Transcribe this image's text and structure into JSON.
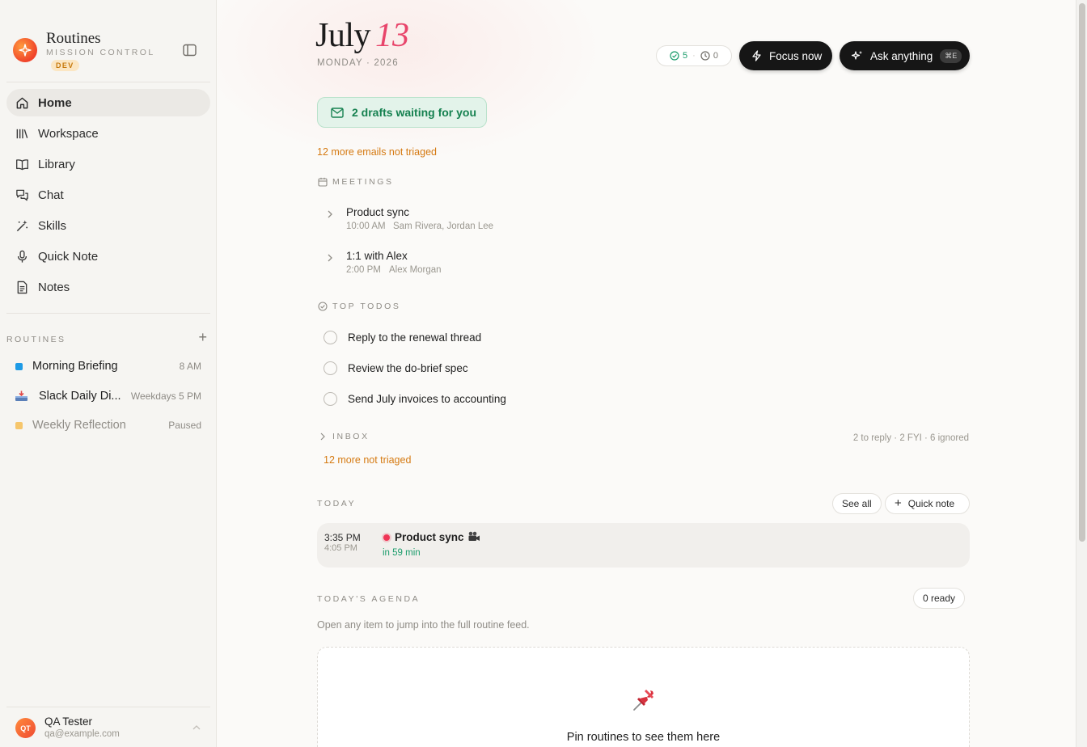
{
  "sidebar": {
    "brand": {
      "title": "Routines",
      "subtitle": "MISSION CONTROL",
      "badge": "DEV"
    },
    "nav": [
      {
        "label": "Home",
        "icon": "home-icon",
        "active": true
      },
      {
        "label": "Workspace",
        "icon": "books-icon"
      },
      {
        "label": "Library",
        "icon": "book-icon"
      },
      {
        "label": "Chat",
        "icon": "chat-icon"
      },
      {
        "label": "Skills",
        "icon": "wand-icon"
      },
      {
        "label": "Quick Note",
        "icon": "microphone-icon"
      },
      {
        "label": "Notes",
        "icon": "document-icon"
      }
    ],
    "routines_label": "ROUTINES",
    "routines": [
      {
        "name": "Morning Briefing",
        "meta": "8 AM",
        "color": "#1e9be6"
      },
      {
        "name": "Slack Daily Di...",
        "meta": "Weekdays 5 PM",
        "icon": "inbox-tray-icon"
      },
      {
        "name": "Weekly Reflection",
        "meta": "Paused",
        "color": "#f6c66c",
        "paused": true
      }
    ],
    "user": {
      "initials": "QT",
      "name": "QA Tester",
      "email": "qa@example.com"
    }
  },
  "header": {
    "month": "July",
    "day": "13",
    "subtitle": "MONDAY · 2026",
    "stats": {
      "done": "5",
      "pending": "0"
    },
    "focus_label": "Focus now",
    "ask_label": "Ask anything",
    "ask_shortcut": "⌘E"
  },
  "drafts_label": "2 drafts waiting for you",
  "emails_not_triaged": "12 more emails not triaged",
  "meetings": {
    "label": "MEETINGS",
    "items": [
      {
        "title": "Product sync",
        "time": "10:00 AM",
        "people": "Sam Rivera, Jordan Lee"
      },
      {
        "title": "1:1 with Alex",
        "time": "2:00 PM",
        "people": "Alex Morgan"
      }
    ]
  },
  "todos": {
    "label": "TOP TODOS",
    "items": [
      "Reply to the renewal thread",
      "Review the do-brief spec",
      "Send July invoices to accounting"
    ]
  },
  "inbox": {
    "label": "INBOX",
    "summary": "2 to reply · 2 FYI · 6 ignored",
    "not_triaged": "12 more not triaged"
  },
  "today": {
    "label": "TODAY",
    "see_all": "See all",
    "quick_note": "Quick note",
    "event": {
      "start": "3:35 PM",
      "end": "4:05 PM",
      "title": "Product sync",
      "countdown": "in 59 min"
    }
  },
  "agenda": {
    "label": "TODAY'S AGENDA",
    "ready": "0 ready",
    "hint": "Open any item to jump into the full routine feed.",
    "empty_text": "Pin routines to see them here"
  },
  "colors": {
    "accent": "#e8456b",
    "success": "#1a9c6b",
    "warning": "#d57a12",
    "dark_button": "#161616"
  }
}
